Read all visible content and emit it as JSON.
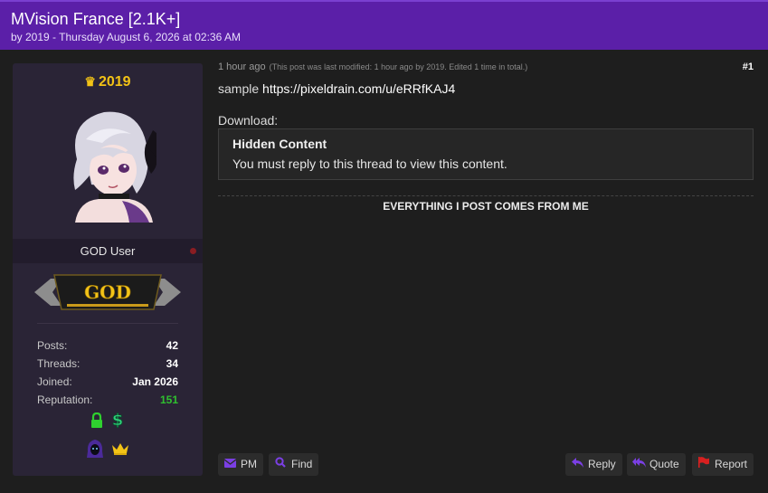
{
  "header": {
    "title": "MVision France [2.1K+]",
    "subtitle": "by 2019 - Thursday August 6, 2026 at 02:36 AM"
  },
  "user": {
    "name": "2019",
    "rank": "GOD User",
    "badge_text": "GOD",
    "stats": [
      {
        "label": "Posts:",
        "value": "42"
      },
      {
        "label": "Threads:",
        "value": "34"
      },
      {
        "label": "Joined:",
        "value": "Jan 2026"
      },
      {
        "label": "Reputation:",
        "value": "151"
      }
    ]
  },
  "post": {
    "time": "1 hour ago",
    "modified_note": "(This post was last modified: 1 hour ago by 2019. Edited 1 time in total.)",
    "number": "#1",
    "sample_label": "sample",
    "sample_link": "https://pixeldrain.com/u/eRRfKAJ4",
    "download_label": "Download:",
    "hidden_title": "Hidden Content",
    "hidden_message": "You must reply to this thread to view this content.",
    "signature": "EVERYTHING I POST COMES FROM ME"
  },
  "buttons": {
    "pm": "PM",
    "find": "Find",
    "reply": "Reply",
    "quote": "Quote",
    "report": "Report"
  },
  "colors": {
    "header_bg": "#5b1fa8",
    "accent": "#7b3fe4",
    "username": "#f3c316",
    "reputation": "#2fc02f",
    "report_icon": "#d82020"
  }
}
